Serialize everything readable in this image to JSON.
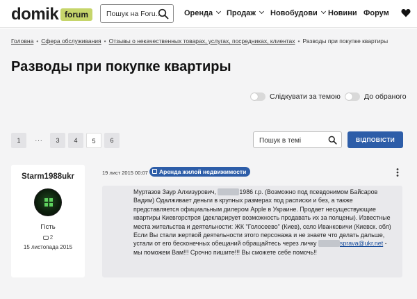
{
  "header": {
    "logo": "domik",
    "logo_badge": "forum",
    "search_placeholder": "Пошук на Foru...",
    "nav": [
      {
        "label": "Оренда",
        "has_dropdown": true
      },
      {
        "label": "Продаж",
        "has_dropdown": true
      },
      {
        "label": "Новобудови",
        "has_dropdown": true
      },
      {
        "label": "Новини",
        "has_dropdown": false
      },
      {
        "label": "Форум",
        "has_dropdown": false
      }
    ]
  },
  "breadcrumb": [
    "Головна",
    "Сфера обслуживания",
    "Отзывы о некачественных товарах, услугах, посредниках, клиентах",
    "Разводы при покупке квартиры"
  ],
  "page_title": "Разводы при покупке квартиры",
  "toggles": {
    "follow": "Слідкувати за темою",
    "favorites": "До обраного"
  },
  "pagination": {
    "first": "1",
    "ellipsis": "...",
    "pages": [
      "3",
      "4",
      "5",
      "6"
    ],
    "current": "5"
  },
  "topic_search_placeholder": "Пошук в темі",
  "reply_button": "ВІДПОВІСТИ",
  "post": {
    "author": "Starm1988ukr",
    "role": "Гість",
    "message_count": "2",
    "join_date": "15 листопада 2015",
    "date": "19 лист 2015 00:07",
    "tag": "Аренда жилой недвижимости",
    "text": {
      "part1": "Муртазов Заур Алхизурович, ",
      "part2": "1986 г.р. (Возможно под псевдонимом Байсаров Вадим) Одалживает деньги в крупных размерах под расписки и без, а также представляется официальным дилером Apple в Украине. Продает несуществующие квартиры Киевгорстроя (декларирует возможность продавать их за полцены). Известные места жительства и деятельности: ЖК \"Голосеево\" (Киев), село Иванковичи (Киевск. обл) Если Вы стали жертвой деятельности этого персонажа и не знаете что делать дальше, устали от его бесконечных обещаний обращайтесь через личку ",
      "email": "sprava@ukr.net",
      "part3": " - мы поможем Вам!!! Срочно пишите!!! Вы сможете себе помочь!!"
    }
  },
  "colors": {
    "accent": "#2d5da8",
    "logo_badge": "#c6d56b",
    "page_bg": "#f4f4f5"
  },
  "icons": [
    "search-icon",
    "chevron-down-icon",
    "heart-icon",
    "message-icon",
    "calendar-icon",
    "more-vertical-icon"
  ]
}
